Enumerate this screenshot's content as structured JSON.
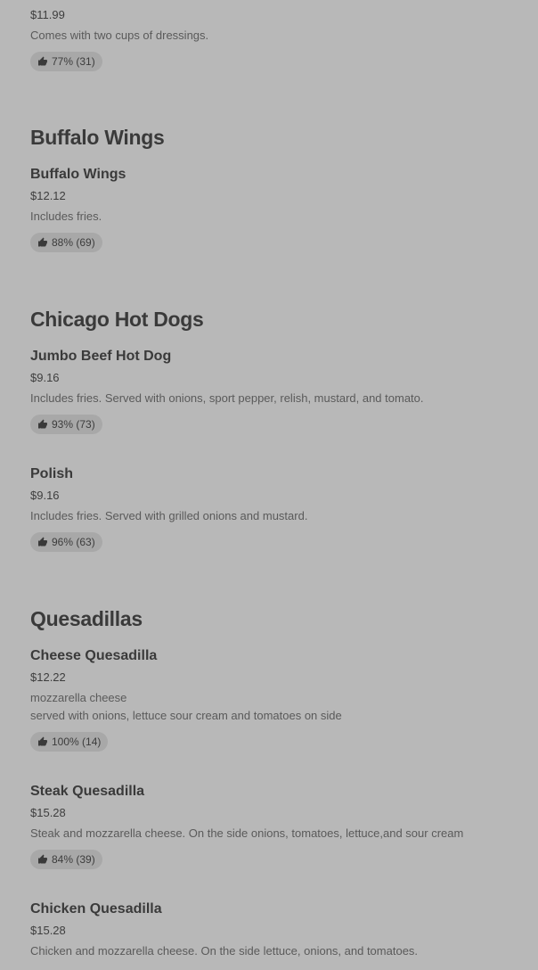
{
  "sections": [
    {
      "title": "",
      "items": [
        {
          "name": "",
          "price": "$11.99",
          "desc": [
            "Comes with two cups of dressings."
          ],
          "rating": "77% (31)"
        }
      ]
    },
    {
      "title": "Buffalo Wings",
      "items": [
        {
          "name": "Buffalo Wings",
          "price": "$12.12",
          "desc": [
            "Includes fries."
          ],
          "rating": "88% (69)"
        }
      ]
    },
    {
      "title": "Chicago Hot Dogs",
      "items": [
        {
          "name": "Jumbo Beef Hot Dog",
          "price": "$9.16",
          "desc": [
            "Includes fries. Served with onions, sport pepper, relish, mustard, and tomato."
          ],
          "rating": "93% (73)"
        },
        {
          "name": "Polish",
          "price": "$9.16",
          "desc": [
            "Includes fries. Served with grilled onions and mustard."
          ],
          "rating": "96% (63)"
        }
      ]
    },
    {
      "title": "Quesadillas",
      "items": [
        {
          "name": "Cheese Quesadilla",
          "price": "$12.22",
          "desc": [
            "mozzarella cheese",
            "served with onions, lettuce sour cream and tomatoes on side"
          ],
          "rating": "100% (14)"
        },
        {
          "name": "Steak Quesadilla",
          "price": "$15.28",
          "desc": [
            "Steak and mozzarella cheese. On the side onions, tomatoes, lettuce,and sour cream"
          ],
          "rating": "84% (39)"
        },
        {
          "name": "Chicken Quesadilla",
          "price": "$15.28",
          "desc": [
            "Chicken and mozzarella cheese. On the side lettuce, onions, and tomatoes."
          ],
          "rating": ""
        }
      ]
    }
  ],
  "icons": {
    "rating": "thumbs-up-icon"
  }
}
